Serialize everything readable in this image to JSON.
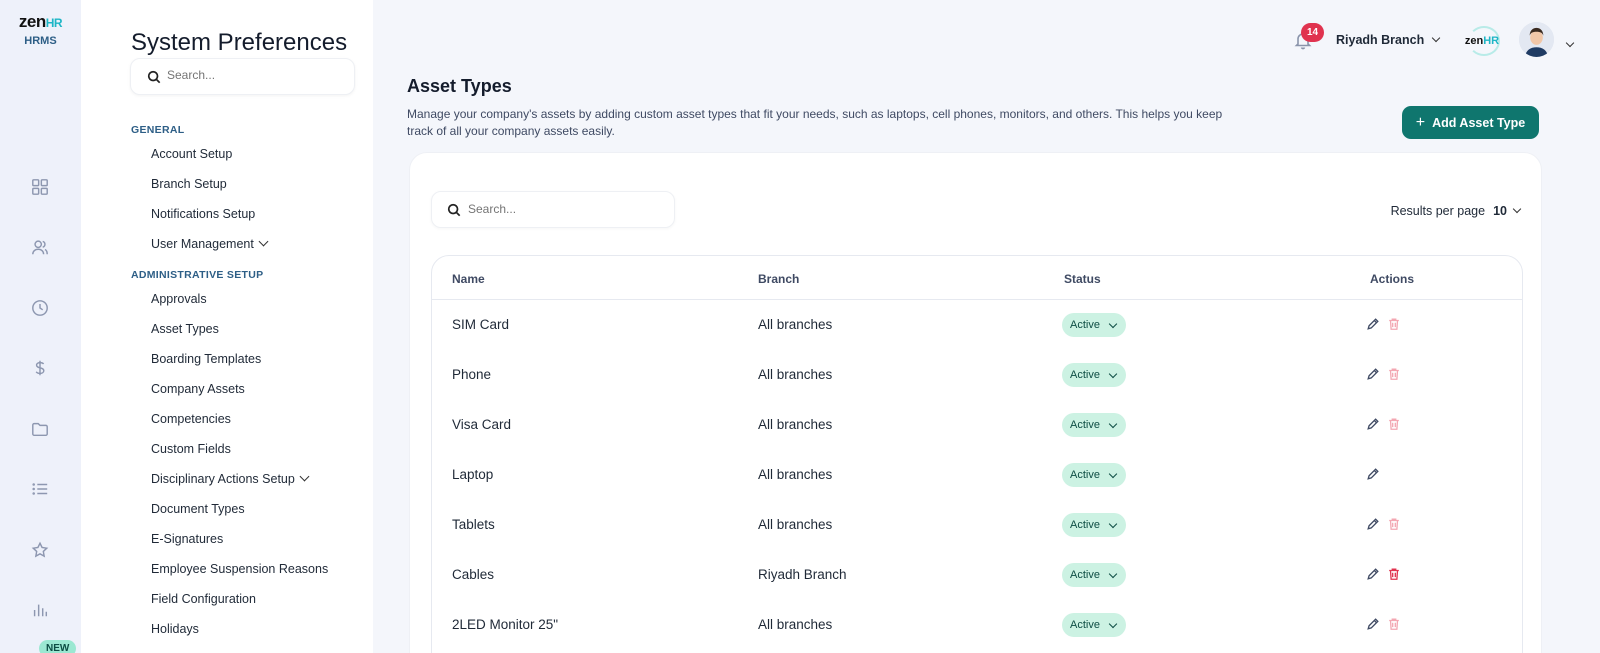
{
  "app": {
    "brand": "zen",
    "brand_hr": "HR",
    "subtitle": "HRMS",
    "new_badge": "NEW"
  },
  "sidebar": {
    "title": "System Preferences",
    "search_placeholder": "Search...",
    "sections": [
      {
        "heading": "GENERAL",
        "items": [
          "Account Setup",
          "Branch Setup",
          "Notifications Setup",
          "User Management"
        ]
      },
      {
        "heading": "ADMINISTRATIVE SETUP",
        "items": [
          "Approvals",
          "Asset Types",
          "Boarding Templates",
          "Company Assets",
          "Competencies",
          "Custom Fields",
          "Disciplinary Actions Setup",
          "Document Types",
          "E-Signatures",
          "Employee Suspension Reasons",
          "Field Configuration",
          "Holidays"
        ]
      }
    ]
  },
  "header": {
    "notification_count": "14",
    "branch": "Riyadh Branch",
    "company_logo_text": "zen",
    "company_logo_hr": "HR"
  },
  "main": {
    "title": "Asset Types",
    "description": "Manage your company's assets by adding custom asset types that fit your needs, such as laptops, cell phones, monitors, and others. This helps you keep track of all your company assets easily.",
    "add_button": "Add Asset Type",
    "table_search_placeholder": "Search...",
    "results_per_page_label": "Results per page",
    "results_per_page_value": "10",
    "columns": [
      "Name",
      "Branch",
      "Status",
      "Actions"
    ],
    "rows": [
      {
        "name": "SIM Card",
        "branch": "All branches",
        "status": "Active"
      },
      {
        "name": "Phone",
        "branch": "All branches",
        "status": "Active"
      },
      {
        "name": "Visa Card",
        "branch": "All branches",
        "status": "Active"
      },
      {
        "name": "Laptop",
        "branch": "All branches",
        "status": "Active"
      },
      {
        "name": "Tablets",
        "branch": "All branches",
        "status": "Active"
      },
      {
        "name": "Cables",
        "branch": "Riyadh Branch",
        "status": "Active"
      },
      {
        "name": "2LED Monitor 25\"",
        "branch": "All branches",
        "status": "Active"
      }
    ]
  },
  "colors": {
    "primary": "#0f766e",
    "status_bg": "#ccf2e3",
    "badge_red": "#e0334f",
    "accent_cyan": "#1eb6c6"
  }
}
